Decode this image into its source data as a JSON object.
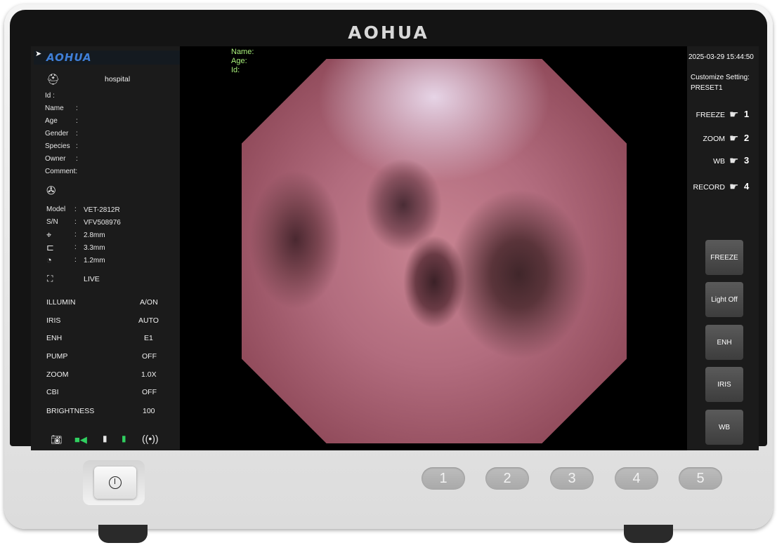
{
  "device": {
    "brand": "AOHUA"
  },
  "left_panel": {
    "logo": "AOHUA",
    "hospital": "hospital",
    "patient": {
      "id_label": "Id :",
      "name_label": "Name",
      "age_label": "Age",
      "gender_label": "Gender",
      "species_label": "Species",
      "owner_label": "Owner",
      "comment_label": "Comment:",
      "sep": ":"
    },
    "scope": {
      "model_label": "Model",
      "model_value": "VET-2812R",
      "sn_label": "S/N",
      "sn_value": "VFV508976",
      "sep": ":",
      "tip_value": "2.8mm",
      "channel_value": "3.3mm",
      "bend_value": "1.2mm"
    },
    "mode": "LIVE",
    "settings": [
      {
        "label": "ILLUMIN",
        "value": "A/ON"
      },
      {
        "label": "IRIS",
        "value": "AUTO"
      },
      {
        "label": "ENH",
        "value": "E1"
      },
      {
        "label": "PUMP",
        "value": "OFF"
      },
      {
        "label": "ZOOM",
        "value": "1.0X"
      },
      {
        "label": "CBI",
        "value": "OFF"
      },
      {
        "label": "BRIGHTNESS",
        "value": "100"
      }
    ],
    "status_icons": [
      "camera-icon",
      "video-icon",
      "usb-icon",
      "sd-card-icon",
      "wifi-icon"
    ]
  },
  "video_overlay": {
    "name_label": "Name:",
    "age_label": "Age:",
    "id_label": "Id:"
  },
  "right_panel": {
    "datetime": "2025-03-29 15:44:50",
    "customize_label": "Customize Setting:",
    "preset": "PRESET1",
    "hotkeys": [
      {
        "label": "FREEZE",
        "num": "1"
      },
      {
        "label": "ZOOM",
        "num": "2"
      },
      {
        "label": "WB",
        "num": "3"
      },
      {
        "label": "RECORD",
        "num": "4"
      }
    ],
    "buttons": [
      "FREEZE",
      "Light Off",
      "ENH",
      "IRIS",
      "WB"
    ]
  },
  "front_buttons": [
    "1",
    "2",
    "3",
    "4",
    "5"
  ],
  "colors": {
    "accent_blue": "#3f7fd8",
    "overlay_green": "#a8f07a",
    "status_green": "#30d060"
  }
}
